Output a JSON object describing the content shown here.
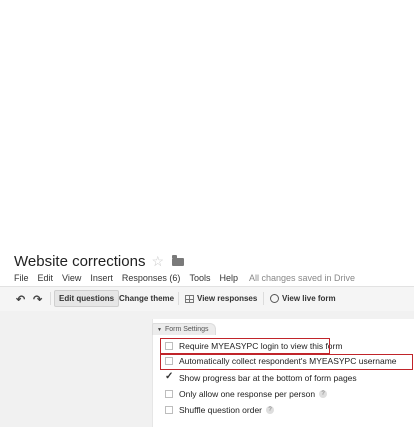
{
  "doc": {
    "title": "Website corrections",
    "star_icon": "star-icon",
    "folder_icon": "folder-icon"
  },
  "menu": {
    "items": [
      "File",
      "Edit",
      "View",
      "Insert",
      "Responses (6)",
      "Tools",
      "Help"
    ],
    "status": "All changes saved in Drive"
  },
  "toolbar": {
    "undo_icon": "undo-icon",
    "redo_icon": "redo-icon",
    "edit_questions": "Edit questions",
    "change_theme": "Change theme",
    "view_responses": "View responses",
    "view_live_form": "View live form"
  },
  "settings": {
    "tab_label": "Form Settings",
    "options": [
      {
        "label": "Require MYEASYPC login to view this form",
        "checked": false
      },
      {
        "label": "Automatically collect respondent's MYEASYPC username",
        "checked": false
      },
      {
        "label": "Show progress bar at the bottom of form pages",
        "checked": true
      },
      {
        "label": "Only allow one response per person",
        "checked": false,
        "help": "?"
      },
      {
        "label": "Shuffle question order",
        "checked": false,
        "help": "?"
      }
    ]
  },
  "colors": {
    "highlight": "#c0242a",
    "toolbar_bg": "#f5f5f5",
    "content_bg": "#f1f1f1"
  }
}
